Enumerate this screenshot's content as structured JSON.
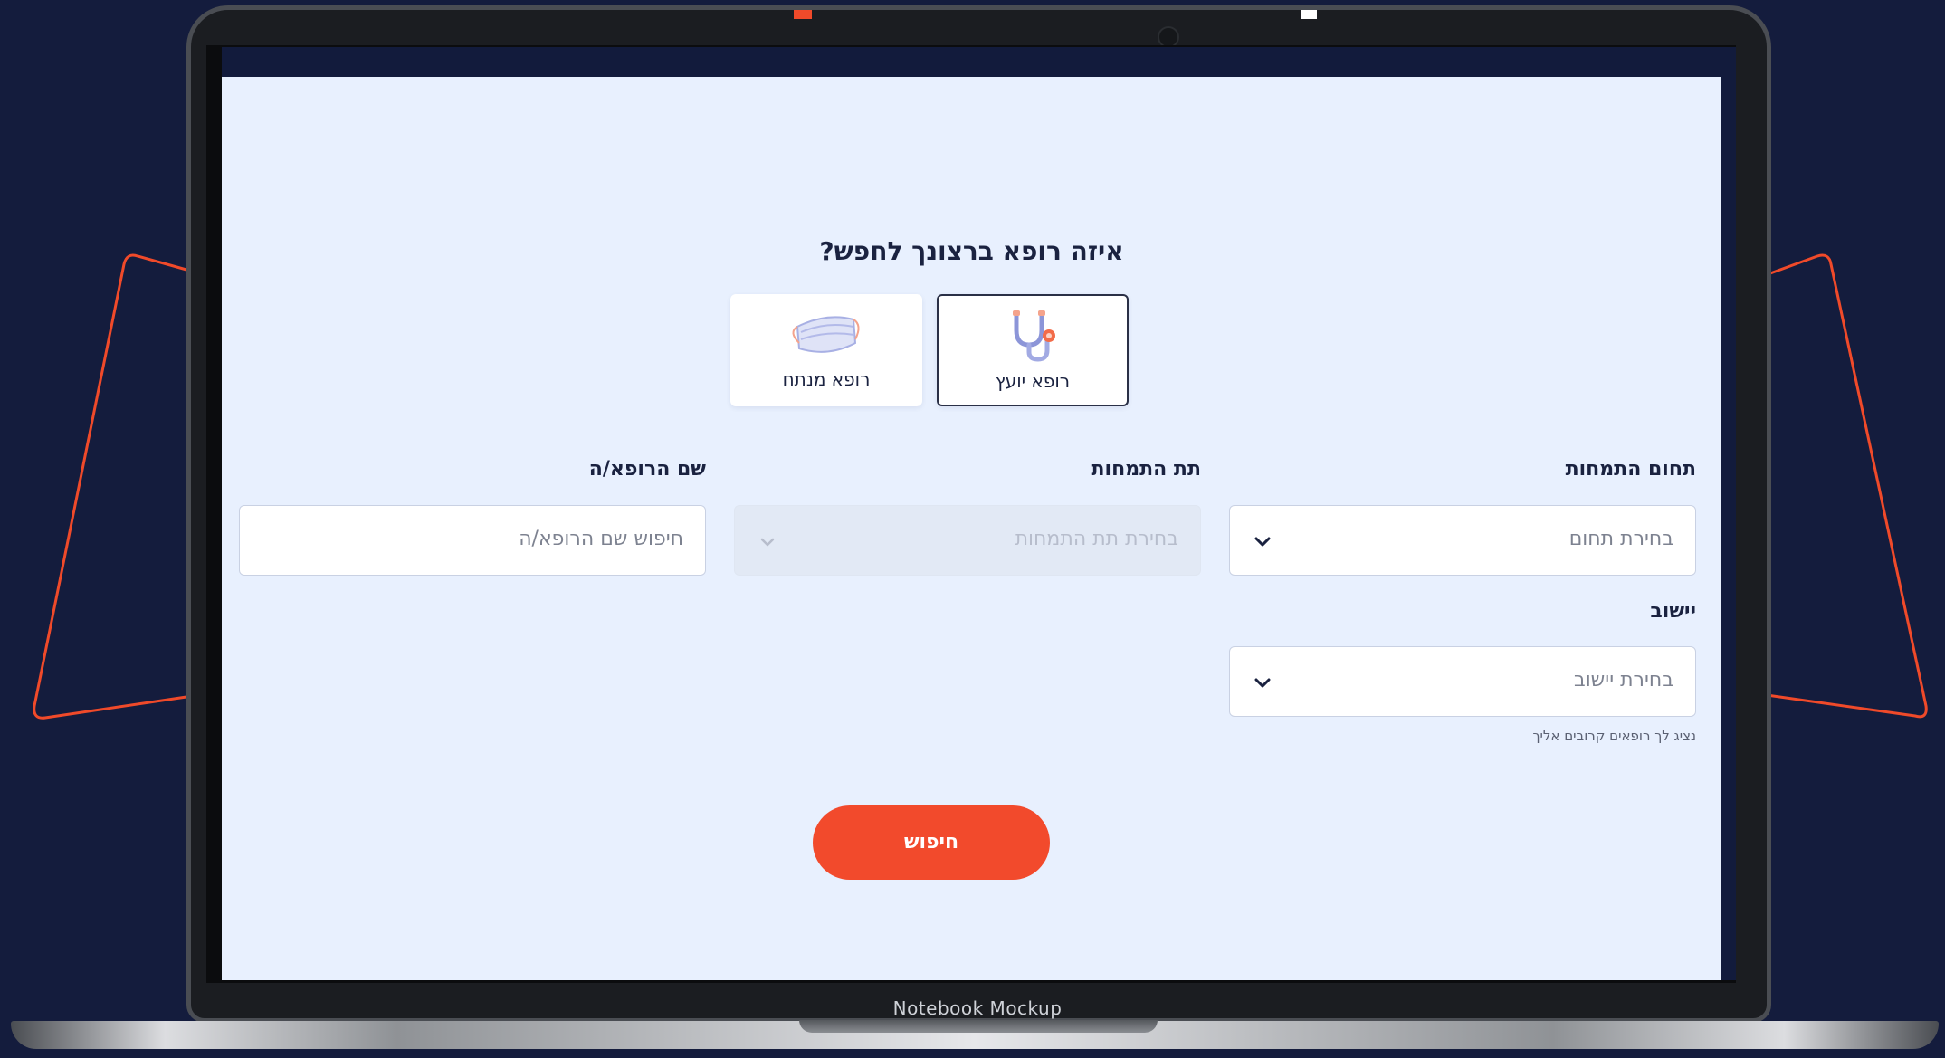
{
  "question": "איזה רופא ברצונך לחפש?",
  "doctor_types": [
    {
      "label": "רופא יועץ",
      "icon": "stethoscope-icon",
      "selected": true
    },
    {
      "label": "רופא מנתח",
      "icon": "surgical-mask-icon",
      "selected": false
    }
  ],
  "filters": {
    "specialty": {
      "label": "תחום התמחות",
      "placeholder": "בחירת תחום"
    },
    "subspecialty": {
      "label": "תת התמחות",
      "placeholder": "בחירת תת התמחות",
      "disabled": true
    },
    "doctor_name": {
      "label": "שם הרופא/ה",
      "placeholder": "חיפוש שם הרופא/ה"
    },
    "locality": {
      "label": "יישוב",
      "placeholder": "בחירת יישוב",
      "hint": "נציג לך רופאים קרובים אליך"
    }
  },
  "search_button": "חיפוש",
  "device_label": "Notebook Mockup",
  "colors": {
    "accent": "#f24a2c",
    "page_bg": "#e8f0fe",
    "outer_bg": "#141c3d",
    "text": "#1a2240"
  }
}
